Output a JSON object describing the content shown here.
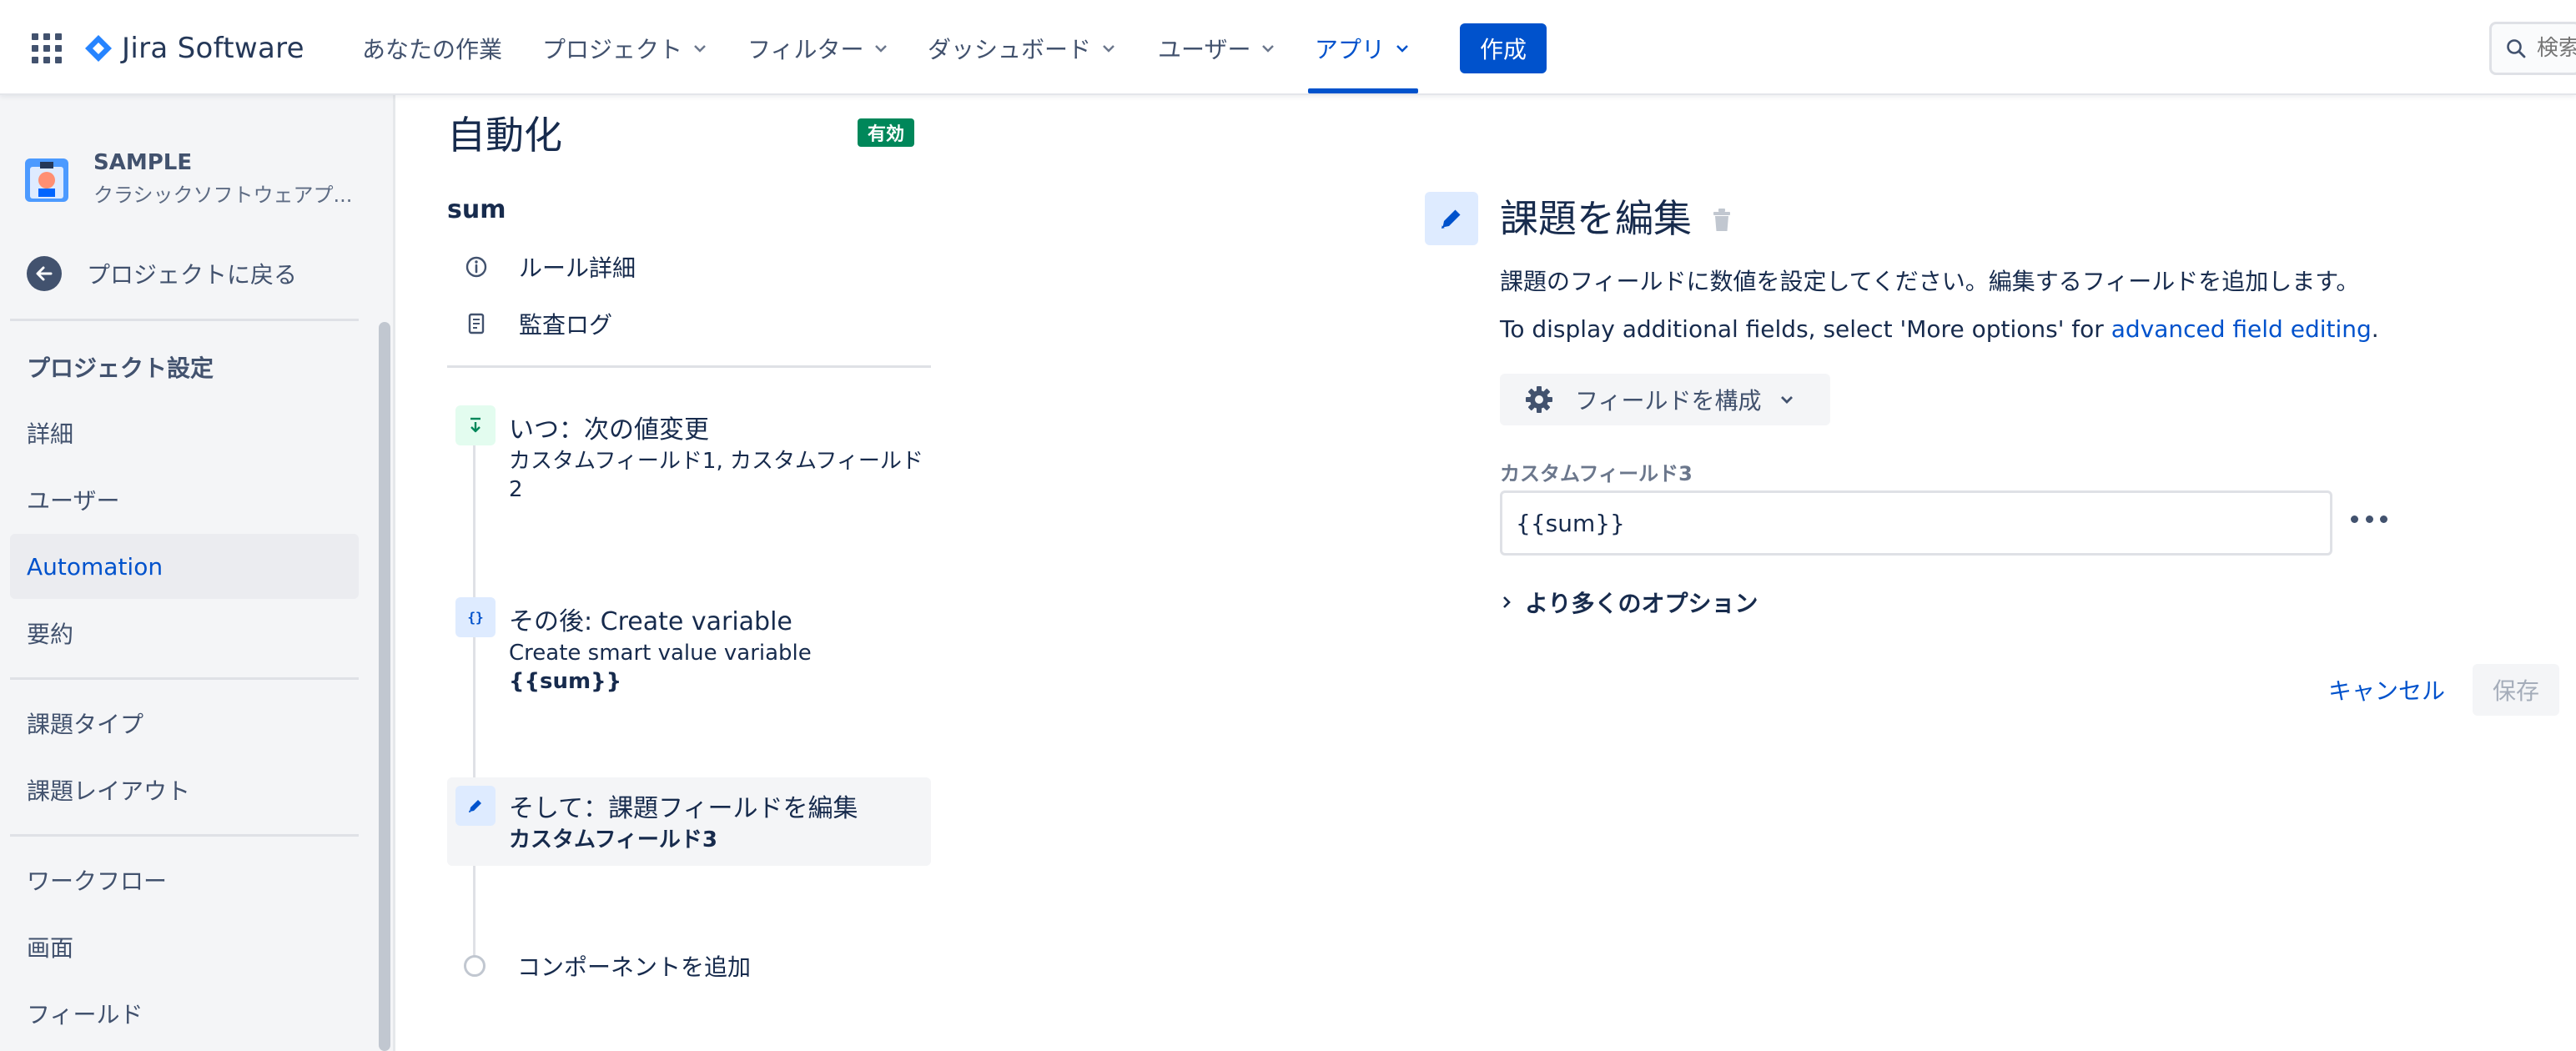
{
  "topnav": {
    "logo_text": "Jira Software",
    "items": [
      {
        "label": "あなたの作業"
      },
      {
        "label": "プロジェクト"
      },
      {
        "label": "フィルター"
      },
      {
        "label": "ダッシュボード"
      },
      {
        "label": "ユーザー"
      },
      {
        "label": "アプリ"
      }
    ],
    "active_item": "アプリ",
    "create_label": "作成",
    "search_placeholder": "検索"
  },
  "sidebar": {
    "project_name": "SAMPLE",
    "project_type": "クラシックソフトウェアプ...",
    "back_label": "プロジェクトに戻る",
    "section_heading": "プロジェクト設定",
    "items": [
      {
        "label": "詳細"
      },
      {
        "label": "ユーザー"
      },
      {
        "label": "Automation"
      },
      {
        "label": "要約"
      },
      {
        "label": "課題タイプ"
      },
      {
        "label": "課題レイアウト"
      },
      {
        "label": "ワークフロー"
      },
      {
        "label": "画面"
      },
      {
        "label": "フィールド"
      }
    ],
    "active_item": "Automation"
  },
  "automation": {
    "title": "自動化",
    "status_badge": "有効",
    "rule_name": "sum",
    "links": [
      {
        "label": "ルール詳細",
        "icon": "info-icon"
      },
      {
        "label": "監査ログ",
        "icon": "document-icon"
      }
    ],
    "steps": [
      {
        "title": "いつ：次の値変更",
        "subtitle": "カスタムフィールド1, カスタムフィールド2",
        "icon": "trigger-icon"
      },
      {
        "title": "その後: Create variable",
        "subtitle": "Create smart value variable",
        "detail": "{{sum}}",
        "icon": "variable-icon"
      },
      {
        "title": "そして：課題フィールドを編集",
        "subtitle": "カスタムフィールド3",
        "icon": "pencil-icon"
      }
    ],
    "add_component_label": "コンポーネントを追加"
  },
  "panel": {
    "title": "課題を編集",
    "description": "課題のフィールドに数値を設定してください。編集するフィールドを追加します。",
    "hint_prefix": "To display additional fields, select 'More options' for ",
    "hint_link": "advanced field editing",
    "hint_suffix": ".",
    "configure_label": "フィールドを構成",
    "field_label": "カスタムフィールド3",
    "field_value": "{{sum}}",
    "more_options_label": "より多くのオプション",
    "cancel_label": "キャンセル",
    "save_label": "保存"
  },
  "colors": {
    "brand_blue": "#0052cc",
    "enabled_green": "#00875a",
    "text": "#172b4d",
    "sidebar_bg": "#f4f5f7"
  }
}
